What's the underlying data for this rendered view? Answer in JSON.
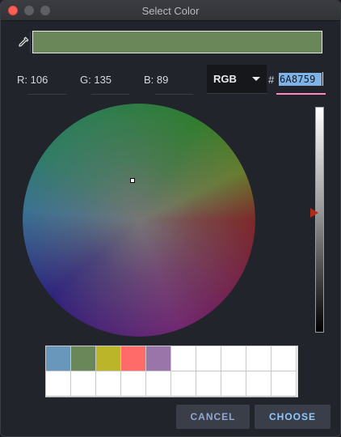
{
  "window": {
    "title": "Select Color"
  },
  "current_color": {
    "hex": "6A8759",
    "r": 106,
    "g": 135,
    "b": 89,
    "swatch_color": "#6A8759"
  },
  "channels": {
    "r_label": "R: 106",
    "g_label": "G: 135",
    "b_label": "B: 89"
  },
  "mode": {
    "selected": "RGB"
  },
  "hex_field": {
    "prefix": "#",
    "value": "6A8759"
  },
  "brightness": {
    "level": 0.55
  },
  "icons": {
    "eyedropper": "eyedropper-icon",
    "dropdown": "chevron-down-icon"
  },
  "recent_colors": [
    "#6897BB",
    "#6A8759",
    "#BBB529",
    "#FF6B68",
    "#9876AA"
  ],
  "buttons": {
    "cancel": "CANCEL",
    "choose": "CHOOSE"
  }
}
